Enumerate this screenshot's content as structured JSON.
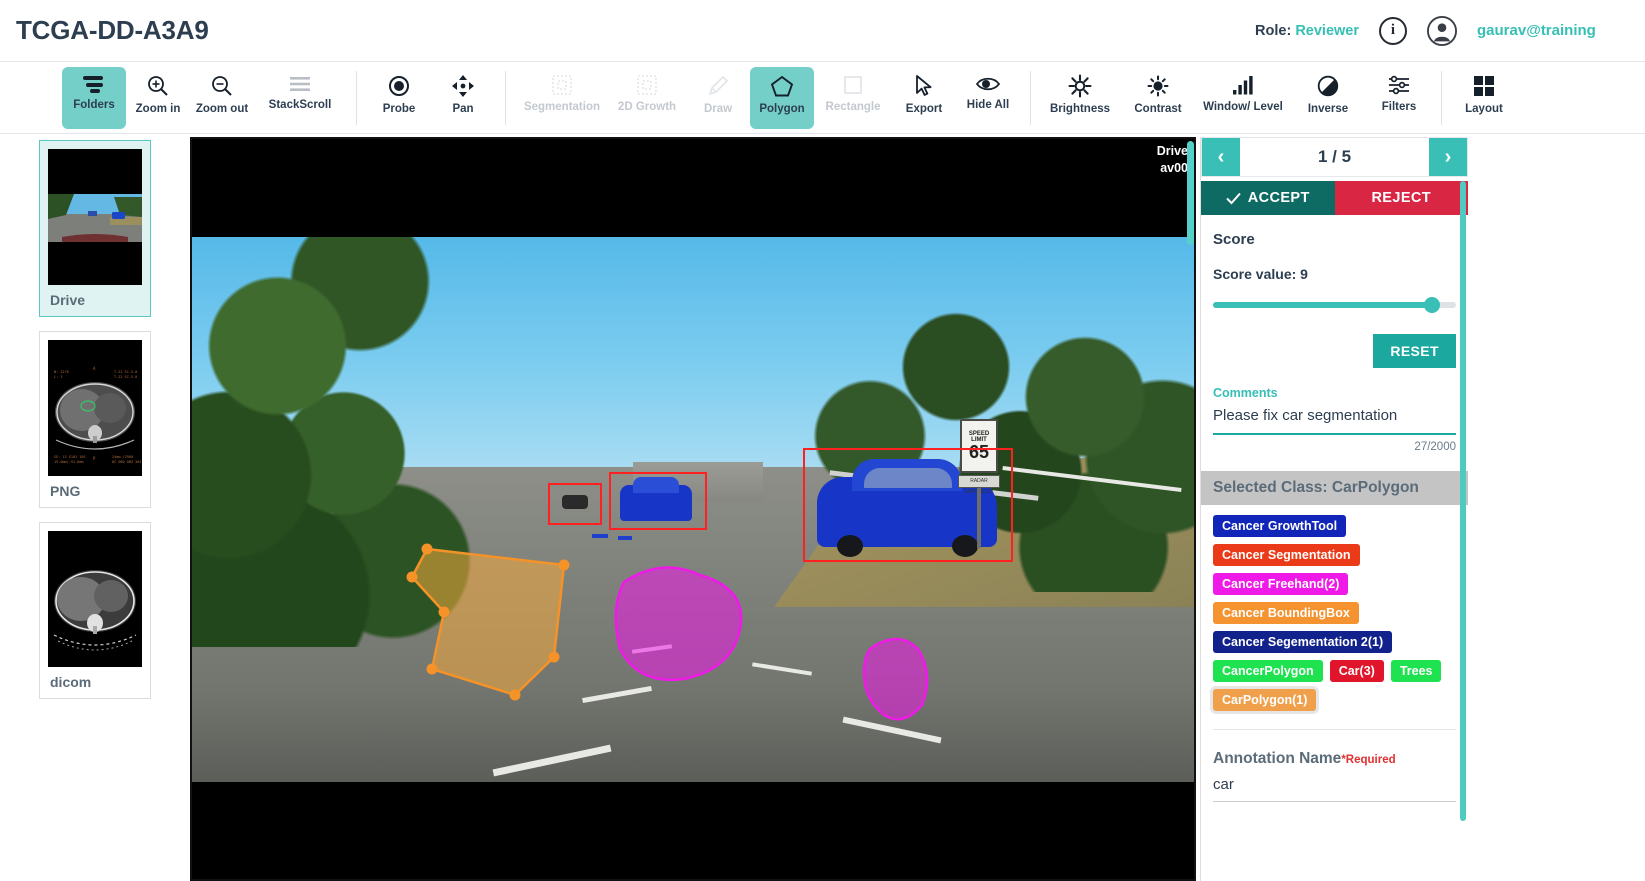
{
  "header": {
    "title": "TCGA-DD-A3A9",
    "role_label": "Role:",
    "role_value": "Reviewer",
    "info_icon": "info-icon",
    "avatar_icon": "user-avatar-icon",
    "user_email": "gaurav@training"
  },
  "toolbar": {
    "items": [
      {
        "label": "Folders",
        "icon": "folders-icon",
        "state": "active"
      },
      {
        "label": "Zoom in",
        "icon": "zoom-in-icon",
        "state": "normal"
      },
      {
        "label": "Zoom out",
        "icon": "zoom-out-icon",
        "state": "normal"
      },
      {
        "label": "StackScroll",
        "icon": "stack-scroll-icon",
        "state": "normal"
      },
      {
        "label": "Probe",
        "icon": "probe-icon",
        "state": "normal"
      },
      {
        "label": "Pan",
        "icon": "pan-icon",
        "state": "normal"
      },
      {
        "label": "Segmentation",
        "icon": "segmentation-icon",
        "state": "disabled"
      },
      {
        "label": "2D Growth",
        "icon": "growth-2d-icon",
        "state": "disabled"
      },
      {
        "label": "Draw",
        "icon": "draw-pencil-icon",
        "state": "disabled"
      },
      {
        "label": "Polygon",
        "icon": "polygon-icon",
        "state": "active"
      },
      {
        "label": "Rectangle",
        "icon": "rectangle-icon",
        "state": "disabled"
      },
      {
        "label": "Export",
        "icon": "cursor-export-icon",
        "state": "normal"
      },
      {
        "label": "Hide All",
        "icon": "eye-hide-icon",
        "state": "normal"
      },
      {
        "label": "Brightness",
        "icon": "brightness-icon",
        "state": "normal"
      },
      {
        "label": "Contrast",
        "icon": "contrast-icon",
        "state": "normal"
      },
      {
        "label": "Window/ Level",
        "icon": "window-level-icon",
        "state": "normal"
      },
      {
        "label": "Inverse",
        "icon": "inverse-icon",
        "state": "normal"
      },
      {
        "label": "Filters",
        "icon": "filters-icon",
        "state": "normal"
      },
      {
        "label": "Layout",
        "icon": "layout-grid-icon",
        "state": "normal"
      }
    ]
  },
  "series_rail": {
    "items": [
      {
        "label": "Drive",
        "kind": "driving-scene-thumbnail",
        "selected": true
      },
      {
        "label": "PNG",
        "kind": "ct-scan-thumbnail",
        "selected": false
      },
      {
        "label": "dicom",
        "kind": "ct-scan-thumbnail",
        "selected": false
      }
    ]
  },
  "viewport": {
    "overlay_line1": "Drive",
    "overlay_line2": "av00"
  },
  "review": {
    "prev_label": "‹",
    "next_label": "›",
    "page_label": "1 / 5",
    "accept_label": "ACCEPT",
    "reject_label": "REJECT",
    "score_heading": "Score",
    "score_value_label": "Score value: 9",
    "score_value": 9,
    "score_min": 0,
    "score_max": 10,
    "reset_label": "RESET",
    "comments_label": "Comments",
    "comments_value": "Please fix car segmentation",
    "comments_count": "27/2000",
    "comments_placeholder": "Comments"
  },
  "classes": {
    "selected_class_label": "Selected Class: CarPolygon",
    "tags": [
      {
        "label": "Cancer GrowthTool",
        "color": "#1126b8",
        "selected": false
      },
      {
        "label": "Cancer Segmentation",
        "color": "#ea3a17",
        "selected": false
      },
      {
        "label": "Cancer Freehand(2)",
        "color": "#ef1ae8",
        "selected": false
      },
      {
        "label": "Cancer BoundingBox",
        "color": "#f59331",
        "selected": false
      },
      {
        "label": "Cancer Segementation 2(1)",
        "color": "#12228c",
        "selected": false
      },
      {
        "label": "CancerPolygon",
        "color": "#1ee250",
        "selected": false
      },
      {
        "label": "Car(3)",
        "color": "#e0152c",
        "selected": false
      },
      {
        "label": "Trees",
        "color": "#1ee250",
        "selected": false
      },
      {
        "label": "CarPolygon(1)",
        "color": "#f0a04b",
        "selected": true
      }
    ]
  },
  "annotation": {
    "name_label": "Annotation Name",
    "required_label": "*Required",
    "name_value": "car",
    "name_placeholder": "Annotation Name"
  },
  "theme": {
    "accent": "#39bfb6",
    "accept": "#0d6b63",
    "reject": "#d92642",
    "text": "#2d3e50"
  }
}
